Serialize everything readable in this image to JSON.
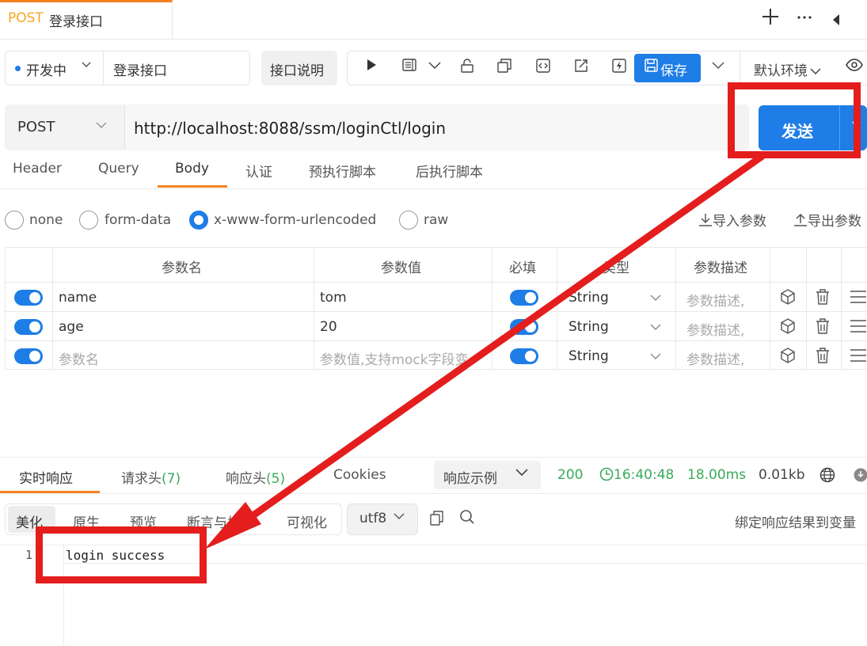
{
  "tab": {
    "method": "POST",
    "title": "登录接口"
  },
  "topbar": {
    "add_icon": "plus-icon",
    "more_icon": "ellipsis-icon",
    "collapse_icon": "caret-left-icon"
  },
  "toolbar": {
    "env_status": "开发中",
    "api_name": "登录接口",
    "doc_button": "接口说明",
    "save_button": "保存",
    "environment": "默认环境",
    "icons": [
      "play-icon",
      "doc-icon",
      "chevron-down-icon",
      "unlock-icon",
      "copy-icon",
      "code-icon",
      "share-icon",
      "lightning-icon",
      "save-icon",
      "chevron-down-icon",
      "eye-icon"
    ]
  },
  "request": {
    "method": "POST",
    "url": "http://localhost:8088/ssm/loginCtl/login",
    "send_button": "发送"
  },
  "req_tabs": [
    "Header",
    "Query",
    "Body",
    "认证",
    "预执行脚本",
    "后执行脚本"
  ],
  "req_tab_active": "Body",
  "body_types": [
    "none",
    "form-data",
    "x-www-form-urlencoded",
    "raw"
  ],
  "body_type_selected": "x-www-form-urlencoded",
  "body_actions": {
    "import": "导入参数",
    "export": "导出参数"
  },
  "params": {
    "headers": [
      "参数名",
      "参数值",
      "必填",
      "类型",
      "参数描述"
    ],
    "rows": [
      {
        "name": "name",
        "value": "tom",
        "type": "String",
        "desc": "参数描述,"
      },
      {
        "name": "age",
        "value": "20",
        "type": "String",
        "desc": "参数描述,"
      },
      {
        "name": "参数名",
        "value": "参数值,支持mock字段变",
        "type": "String",
        "desc": "参数描述,"
      }
    ]
  },
  "response": {
    "tabs": [
      {
        "label": "实时响应",
        "count": ""
      },
      {
        "label": "请求头",
        "count": "(7)"
      },
      {
        "label": "响应头",
        "count": "(5)"
      },
      {
        "label": "Cookies",
        "count": ""
      }
    ],
    "example": "响应示例",
    "status": "200",
    "time": "16:40:48",
    "duration": "18.00ms",
    "size": "0.01kb",
    "view_modes": [
      "美化",
      "原生",
      "预览",
      "断言与校验",
      "可视化"
    ],
    "encoding": "utf8",
    "bind_label": "绑定响应结果到变量",
    "line_number": "1",
    "body": "login success"
  },
  "colors": {
    "accent": "#1e7de6",
    "tab_active": "#f58220",
    "success": "#3aaa5a",
    "annotation": "#e41d1d"
  }
}
